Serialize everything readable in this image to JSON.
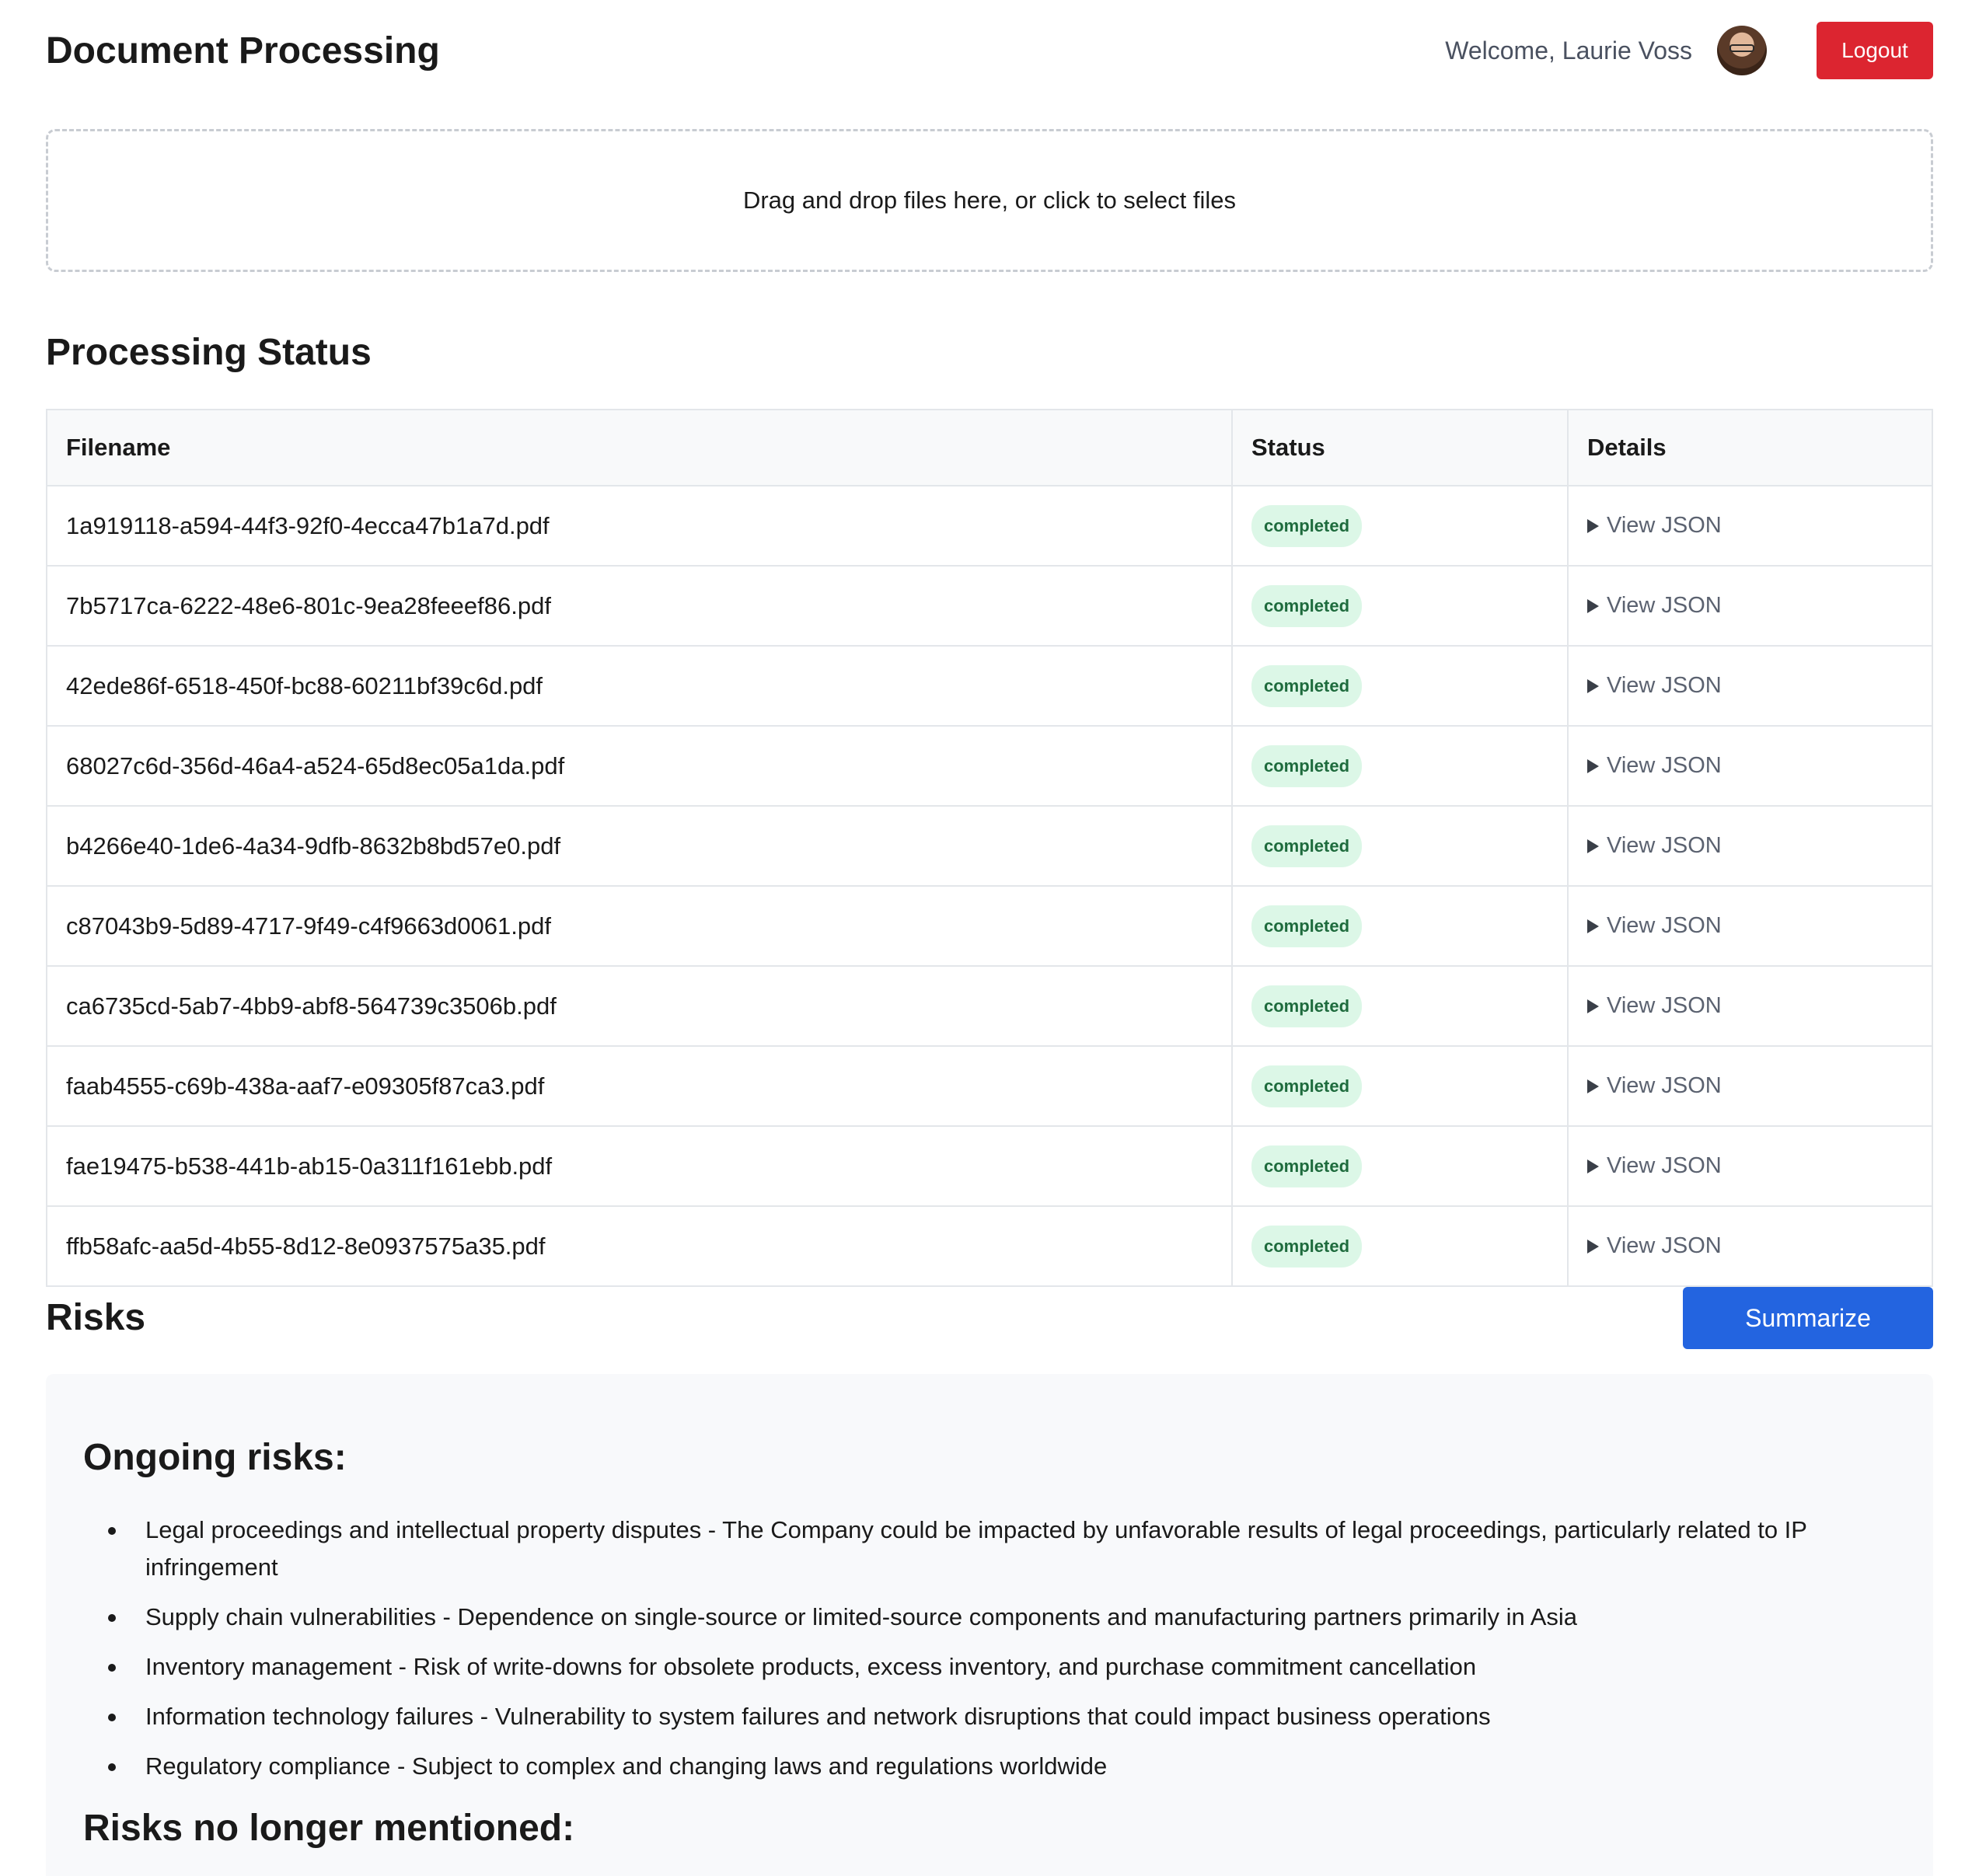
{
  "header": {
    "title": "Document Processing",
    "welcome": "Welcome, Laurie Voss",
    "logout_label": "Logout"
  },
  "dropzone": {
    "text": "Drag and drop files here, or click to select files"
  },
  "processing": {
    "title": "Processing Status",
    "columns": [
      "Filename",
      "Status",
      "Details"
    ],
    "rows": [
      {
        "filename": "1a919118-a594-44f3-92f0-4ecca47b1a7d.pdf",
        "status": "completed",
        "details": "View JSON"
      },
      {
        "filename": "7b5717ca-6222-48e6-801c-9ea28feeef86.pdf",
        "status": "completed",
        "details": "View JSON"
      },
      {
        "filename": "42ede86f-6518-450f-bc88-60211bf39c6d.pdf",
        "status": "completed",
        "details": "View JSON"
      },
      {
        "filename": "68027c6d-356d-46a4-a524-65d8ec05a1da.pdf",
        "status": "completed",
        "details": "View JSON"
      },
      {
        "filename": "b4266e40-1de6-4a34-9dfb-8632b8bd57e0.pdf",
        "status": "completed",
        "details": "View JSON"
      },
      {
        "filename": "c87043b9-5d89-4717-9f49-c4f9663d0061.pdf",
        "status": "completed",
        "details": "View JSON"
      },
      {
        "filename": "ca6735cd-5ab7-4bb9-abf8-564739c3506b.pdf",
        "status": "completed",
        "details": "View JSON"
      },
      {
        "filename": "faab4555-c69b-438a-aaf7-e09305f87ca3.pdf",
        "status": "completed",
        "details": "View JSON"
      },
      {
        "filename": "fae19475-b538-441b-ab15-0a311f161ebb.pdf",
        "status": "completed",
        "details": "View JSON"
      },
      {
        "filename": "ffb58afc-aa5d-4b55-8d12-8e0937575a35.pdf",
        "status": "completed",
        "details": "View JSON"
      }
    ]
  },
  "risks": {
    "title": "Risks",
    "summarize_label": "Summarize",
    "ongoing_title": "Ongoing risks:",
    "ongoing_items": [
      "Legal proceedings and intellectual property disputes - The Company could be impacted by unfavorable results of legal proceedings, particularly related to IP infringement",
      "Supply chain vulnerabilities - Dependence on single-source or limited-source components and manufacturing partners primarily in Asia",
      "Inventory management - Risk of write-downs for obsolete products, excess inventory, and purchase commitment cancellation",
      "Information technology failures - Vulnerability to system failures and network disruptions that could impact business operations",
      "Regulatory compliance - Subject to complex and changing laws and regulations worldwide"
    ],
    "no_longer_title": "Risks no longer mentioned:"
  },
  "colors": {
    "logout": "#dc2530",
    "summarize": "#2364e0",
    "badge_bg": "#dcf7e7",
    "badge_text": "#1e6b3d"
  }
}
